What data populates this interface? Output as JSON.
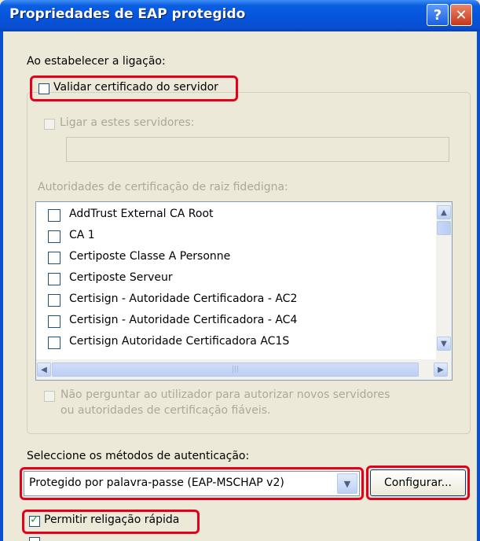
{
  "window": {
    "title": "Propriedades de EAP protegido",
    "help_glyph": "?",
    "close_glyph": "✕"
  },
  "connection": {
    "section_label": "Ao estabelecer a ligação:",
    "validate_cert_label": "Validar certificado do servidor",
    "validate_cert_checked": false,
    "connect_servers_label": "Ligar a estes servidores:",
    "connect_servers_value": "",
    "trusted_root_label": "Autoridades de certificação de raiz fidedigna:",
    "ca_list": [
      {
        "label": "AddTrust External CA Root",
        "checked": false
      },
      {
        "label": "CA 1",
        "checked": false
      },
      {
        "label": "Certiposte Classe A Personne",
        "checked": false
      },
      {
        "label": "Certiposte Serveur",
        "checked": false
      },
      {
        "label": "Certisign - Autoridade Certificadora - AC2",
        "checked": false
      },
      {
        "label": "Certisign - Autoridade Certificadora - AC4",
        "checked": false
      },
      {
        "label": "Certisign Autoridade Certificadora AC1S",
        "checked": false
      }
    ],
    "no_prompt_line1": "Não perguntar ao utilizador para autorizar novos servidores",
    "no_prompt_line2": "ou autoridades de certificação fiáveis."
  },
  "auth": {
    "section_label": "Seleccione os métodos de autenticação:",
    "method_selected": "Protegido por palavra-passe (EAP-MSCHAP v2)",
    "configure_label": "Configurar...",
    "fast_reconnect_label": "Permitir religação rápida",
    "fast_reconnect_checked": true
  },
  "colors": {
    "title_bar": "#0554dc",
    "highlight": "#e3001b",
    "dialog_bg": "#ece9d8"
  }
}
